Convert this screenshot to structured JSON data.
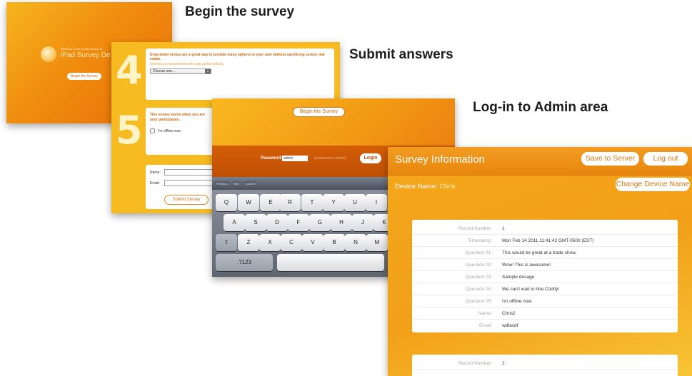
{
  "captions": {
    "step1": "Begin the survey",
    "step2": "Submit answers",
    "step3": "Log-in to Admin area"
  },
  "screen1": {
    "welcome_text": "Welcome to the Codify Design to",
    "app_title": "iPad Survey De",
    "begin_button": "Begin the Survey"
  },
  "screen2": {
    "q4_number": "4",
    "q4_text": "Drop-down menus are a great way to provide many options to your user without sacrificing screen real estate.",
    "q4_sub": "(choose an answer from the pop up list below)",
    "q4_select": "Choose one...",
    "q5_number": "5",
    "q5_text": "This survey works when you are",
    "q5_text2": "your participants.",
    "q5_checkbox": "I'm offline now.",
    "name_label": "Name:",
    "email_label": "Email:",
    "submit_button": "Submit Survey"
  },
  "screen3": {
    "begin_button": "Begin the Survey",
    "password_label": "Password:",
    "password_value": "admin",
    "password_hint": "(password is admin)",
    "login_button": "Login",
    "kb_previous": "Previous",
    "kb_next": "Next",
    "kb_autofill": "AutoFill",
    "keys_row1": [
      "Q",
      "W",
      "E",
      "R",
      "T",
      "Y",
      "U",
      "I"
    ],
    "keys_row2": [
      "A",
      "S",
      "D",
      "F",
      "G",
      "H",
      "J",
      "K"
    ],
    "keys_row3": [
      "⇧",
      "Z",
      "X",
      "C",
      "V",
      "B",
      "N",
      "M"
    ],
    "key_numbers": ".?123"
  },
  "screen4": {
    "title": "Survey Information",
    "save_button": "Save to Server",
    "logout_button": "Log out",
    "device_label": "Device Name:",
    "device_name": "Chris",
    "change_device_button": "Change Device Name",
    "record1": [
      {
        "label": "Record Number:",
        "value": "1"
      },
      {
        "label": "Timestamp:",
        "value": "Mon Feb 14 2011 11:41:42 GMT-0500 (EST)"
      },
      {
        "label": "Question 01:",
        "value": "This would be great at a trade show."
      },
      {
        "label": "Question 02:",
        "value": "Wow! This is awesome!"
      },
      {
        "label": "Question 03:",
        "value": "Sample dosage"
      },
      {
        "label": "Question 04:",
        "value": "We can't wait to hire Cödify!"
      },
      {
        "label": "Question 05:",
        "value": "I'm offline now."
      },
      {
        "label": "Name:",
        "value": "Chris2"
      },
      {
        "label": "Email:",
        "value": "wdfasdf"
      }
    ],
    "record2": [
      {
        "label": "Record Number:",
        "value": "2"
      }
    ]
  }
}
